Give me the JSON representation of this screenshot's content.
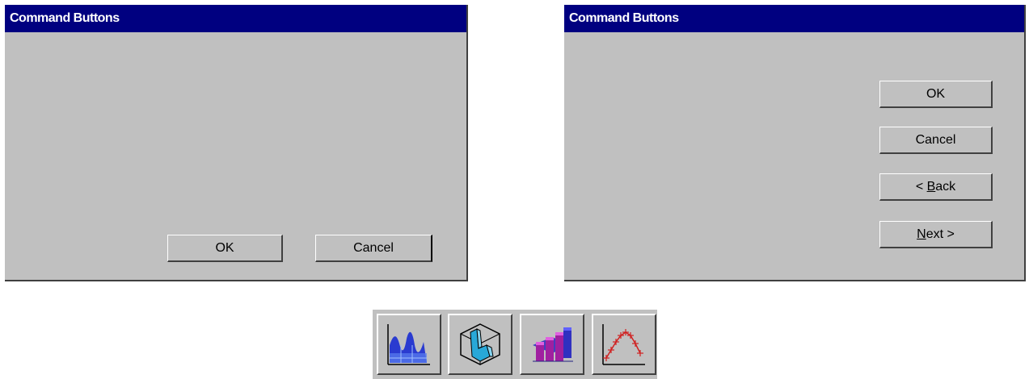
{
  "left_dialog": {
    "title": "Command Buttons",
    "buttons": {
      "ok": "OK",
      "cancel": "Cancel"
    }
  },
  "right_dialog": {
    "title": "Command Buttons",
    "buttons": {
      "ok": "OK",
      "cancel": "Cancel",
      "back_prefix": "< ",
      "back_mnemonic": "B",
      "back_rest": "ack",
      "next_mnemonic": "N",
      "next_rest": "ext >"
    }
  },
  "toolbar": {
    "tools": [
      {
        "icon": "area-chart-icon"
      },
      {
        "icon": "3d-surface-chart-icon"
      },
      {
        "icon": "3d-bar-chart-icon"
      },
      {
        "icon": "line-points-chart-icon"
      }
    ]
  },
  "colors": {
    "title_bar": "#000080",
    "dialog_face": "#c0c0c0",
    "shadow": "#404040",
    "highlight": "#ffffff"
  }
}
